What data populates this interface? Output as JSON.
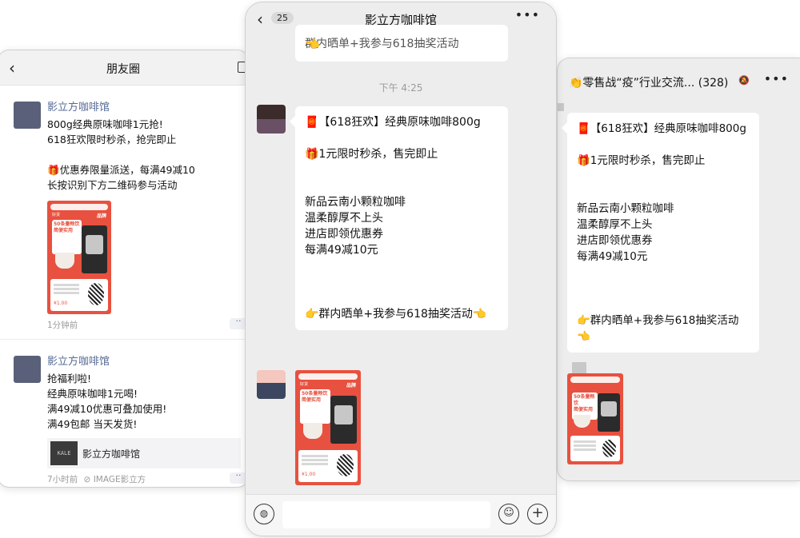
{
  "moments": {
    "title": "朋友圈",
    "posts": [
      {
        "name": "影立方咖啡馆",
        "text": "800g经典原味咖啡1元抢!\n618狂欢限时秒杀，抢完即止\n\n🎁优惠券限量派送，每满49减10\n长按识别下方二维码参与活动",
        "time": "1分钟前"
      },
      {
        "name": "影立方咖啡馆",
        "text": "抢福利啦!\n经典原味咖啡1元喝!\n满49减10优惠可叠加使用!\n满49包邮 当天发货!",
        "link_title": "影立方咖啡馆",
        "link_thumb_text": "KALE",
        "time": "7小时前",
        "source": "IMAGE影立方"
      }
    ]
  },
  "chat": {
    "back_count": "25",
    "title": "影立方咖啡馆",
    "cut_text": "群内晒单+我参与618抽奖活动",
    "time_divider": "下午 4:25",
    "message": "🧧【618狂欢】经典原味咖啡800g\n\n🎁1元限时秒杀，售完即止\n\n\n新品云南小颗粒咖啡\n温柔醇厚不上头\n进店即领优惠券\n每满49减10元\n\n\n\n👉群内晒单+我参与618抽奖活动👈"
  },
  "group": {
    "title": "👏零售战“疫”行业交流... (328)",
    "message": "🧧【618狂欢】经典原味咖啡800g\n\n🎁1元限时秒杀，售完即止\n\n\n新品云南小颗粒咖啡\n温柔醇厚不上头\n进店即领优惠券\n每满49减10元\n\n\n\n👉群内晒单+我参与618抽奖活动👈"
  },
  "poster": {
    "tag": "好货",
    "brand": "品牌",
    "line1": "50条量畅饮",
    "line2": "简便实用",
    "price": "¥1.00"
  },
  "colors": {
    "link_blue": "#576b95",
    "poster_red": "#e8513f",
    "chat_bg": "#ededed"
  }
}
